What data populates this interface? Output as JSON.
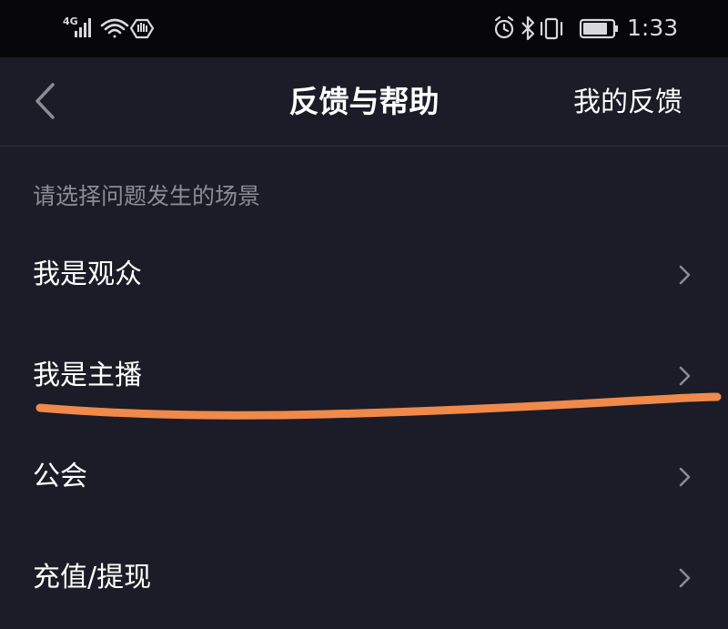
{
  "status_bar": {
    "network": "4G",
    "time": "1:33"
  },
  "nav": {
    "title": "反馈与帮助",
    "right_label": "我的反馈"
  },
  "section": {
    "title": "请选择问题发生的场景"
  },
  "menu": {
    "items": [
      {
        "label": "我是观众"
      },
      {
        "label": "我是主播"
      },
      {
        "label": "公会"
      },
      {
        "label": "充值/提现"
      }
    ]
  },
  "colors": {
    "background": "#1b1c27",
    "status_bar": "#07070a",
    "annotation": "#f0894a"
  }
}
